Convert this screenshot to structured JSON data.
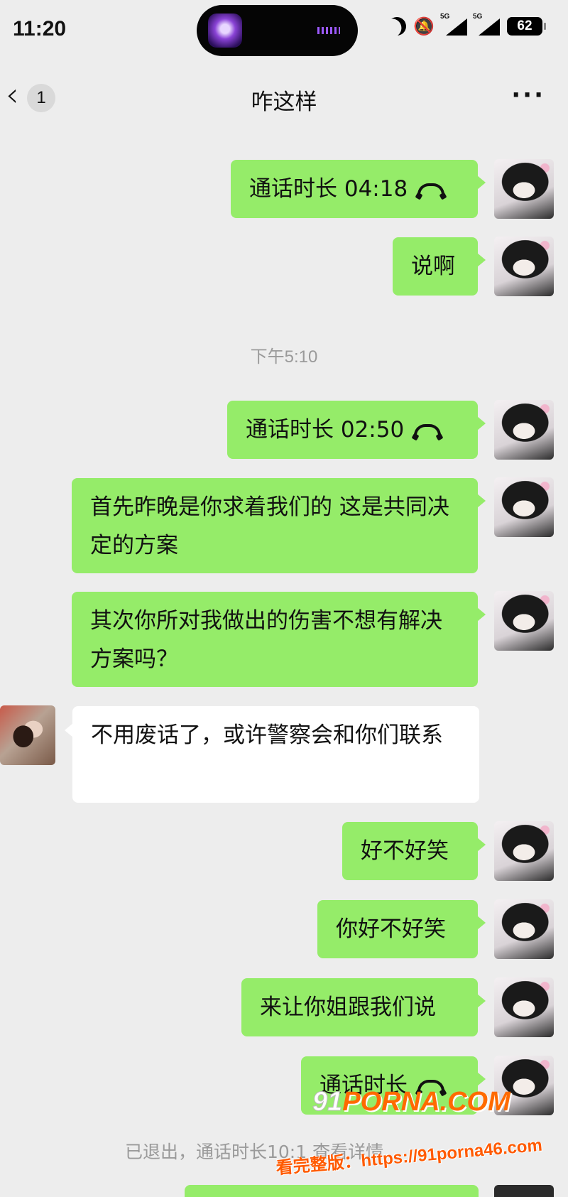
{
  "status_bar": {
    "time": "11:20",
    "network_1": "5G",
    "network_2": "5G",
    "battery": "62"
  },
  "nav": {
    "unread_count": "1",
    "title": "咋这样"
  },
  "timestamp": "下午5:10",
  "messages": [
    {
      "from": "self",
      "text": "通话时长 04:18",
      "call": true
    },
    {
      "from": "self",
      "text": "说啊"
    },
    {
      "from": "self",
      "text": "通话时长 02:50",
      "call": true
    },
    {
      "from": "self",
      "text": "首先昨晚是你求着我们的 这是共同决定的方案"
    },
    {
      "from": "self",
      "text": "其次你所对我做出的伤害不想有解决方案吗？"
    },
    {
      "from": "other",
      "text": "不用废话了，或许警察会和你们联系"
    },
    {
      "from": "self",
      "text": "好不好笑"
    },
    {
      "from": "self",
      "text": "你好不好笑"
    },
    {
      "from": "self",
      "text": "来让你姐跟我们说"
    },
    {
      "from": "self",
      "text": "通话时长",
      "call": true
    }
  ],
  "system_note": "已退出，通话时长10:1  查看详情",
  "watermark": {
    "logo_91": "91",
    "logo_text": "PORNA.COM",
    "line": "看完整版：https://91porna46.com"
  }
}
